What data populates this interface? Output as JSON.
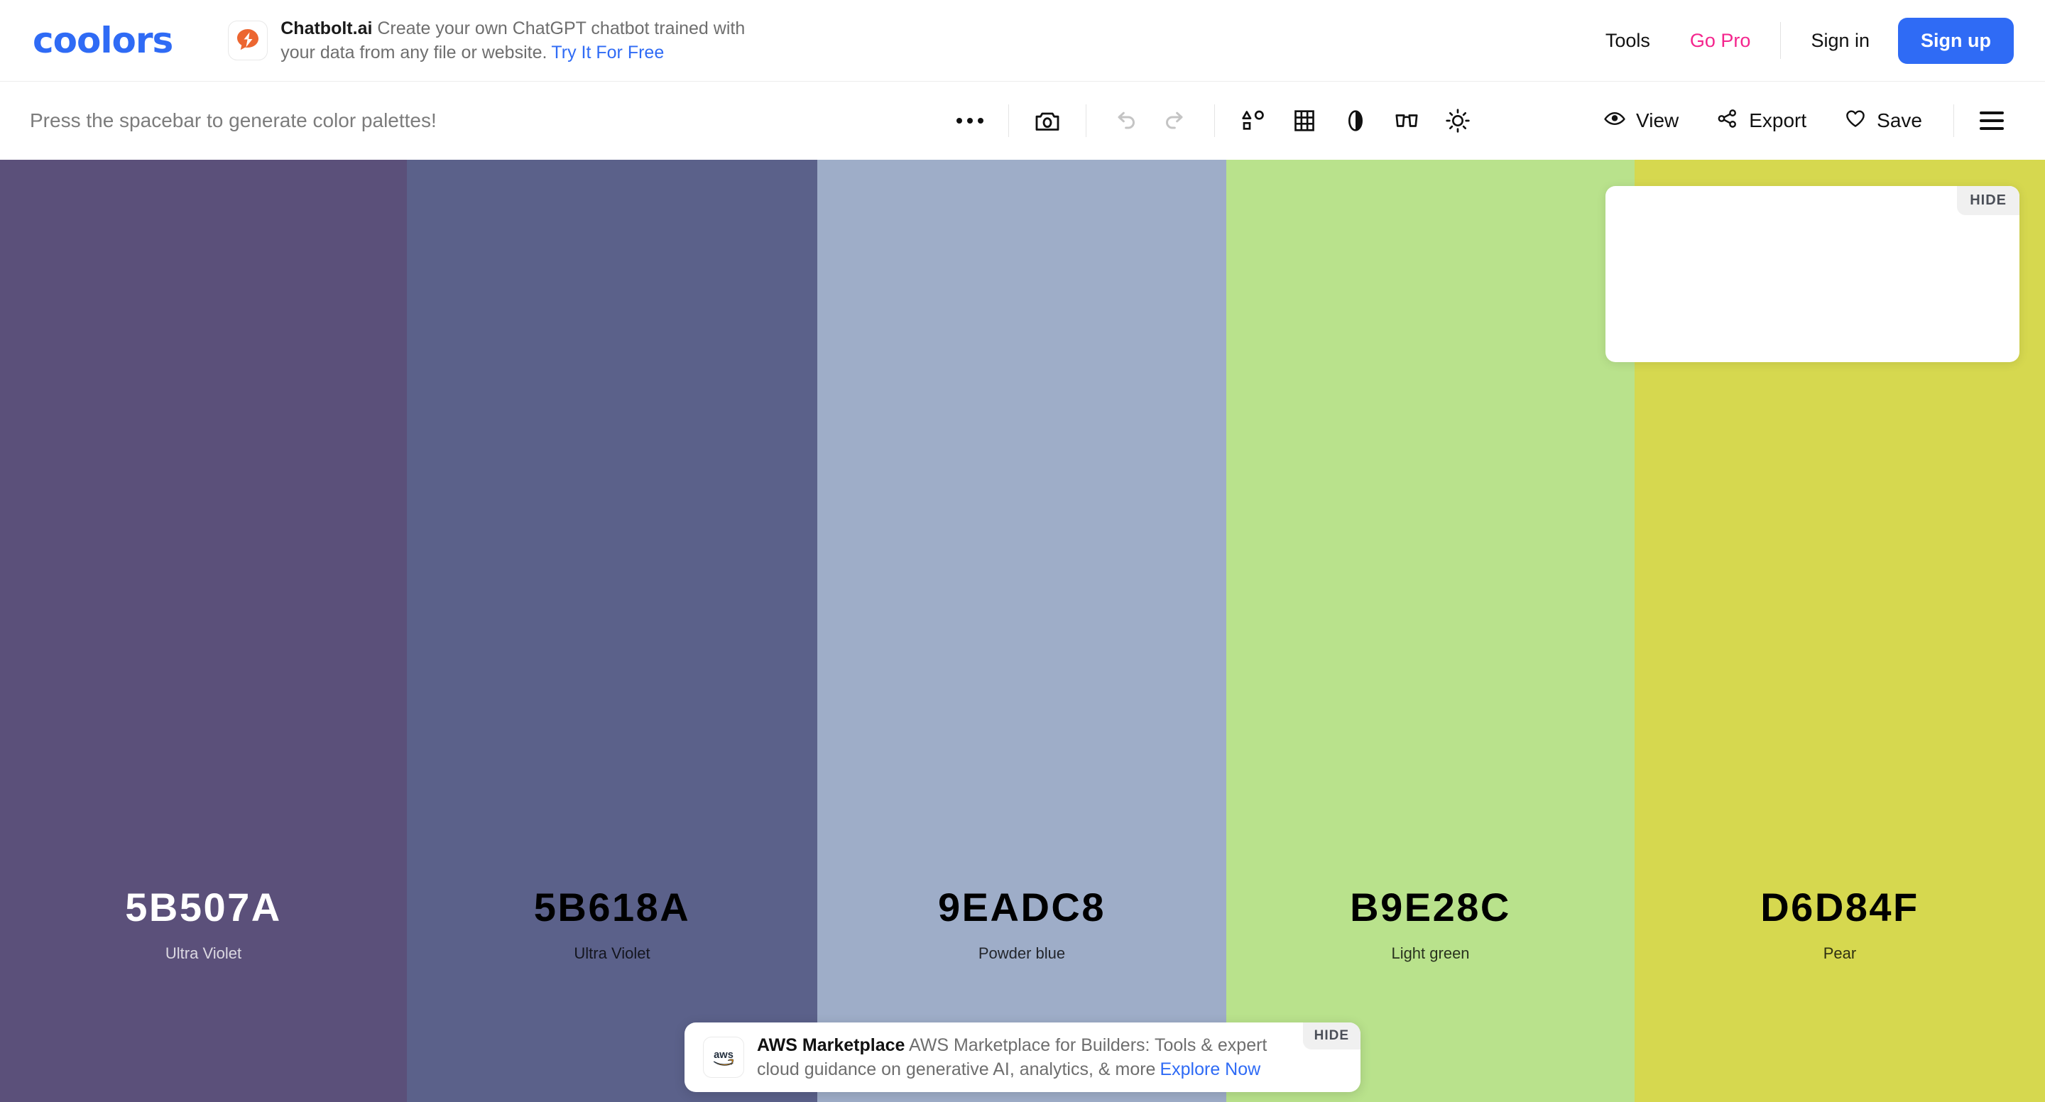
{
  "header": {
    "logo_text": "coolors",
    "logo_color": "#2f6bf5",
    "promo": {
      "icon_name": "chatbolt-lightning-icon",
      "brand": "Chatbolt.ai",
      "description": "Create your own ChatGPT chatbot trained with your data from any file or website.",
      "cta": "Try It For Free"
    },
    "nav": {
      "tools": "Tools",
      "go_pro": "Go Pro",
      "go_pro_color": "#f4258d",
      "sign_in": "Sign in",
      "sign_up": "Sign up",
      "sign_up_bg": "#2f6bf5"
    }
  },
  "toolbar": {
    "hint": "Press the spacebar to generate color palettes!",
    "icons": [
      {
        "name": "more-options-icon",
        "title": "More"
      },
      {
        "name": "camera-icon",
        "title": "Screenshot"
      },
      {
        "name": "undo-icon",
        "title": "Undo"
      },
      {
        "name": "redo-icon",
        "title": "Redo"
      },
      {
        "name": "shapes-icon",
        "title": "Shapes"
      },
      {
        "name": "grid-icon",
        "title": "Grid"
      },
      {
        "name": "contrast-icon",
        "title": "Contrast"
      },
      {
        "name": "glasses-icon",
        "title": "Color blindness"
      },
      {
        "name": "brightness-icon",
        "title": "Brightness"
      }
    ],
    "view_label": "View",
    "export_label": "Export",
    "save_label": "Save",
    "menu_name": "hamburger-menu-icon"
  },
  "palette": [
    {
      "hex": "5B507A",
      "color": "#5B507A",
      "name": "Ultra Violet",
      "text_color": "#ffffff"
    },
    {
      "hex": "5B618A",
      "color": "#5B618A",
      "name": "Ultra Violet",
      "text_color": "#000000"
    },
    {
      "hex": "9EADC8",
      "color": "#9EADC8",
      "name": "Powder blue",
      "text_color": "#000000"
    },
    {
      "hex": "B9E28C",
      "color": "#B9E28C",
      "name": "Light green",
      "text_color": "#000000"
    },
    {
      "hex": "D6D84F",
      "color": "#D6D84F",
      "name": "Pear",
      "text_color": "#000000"
    }
  ],
  "float_ad": {
    "hide_label": "HIDE"
  },
  "aws_banner": {
    "icon_name": "aws-logo-icon",
    "brand": "AWS Marketplace",
    "description": "AWS Marketplace for Builders: Tools & expert cloud guidance on generative AI, analytics, & more",
    "cta": "Explore Now",
    "hide_label": "HIDE"
  }
}
